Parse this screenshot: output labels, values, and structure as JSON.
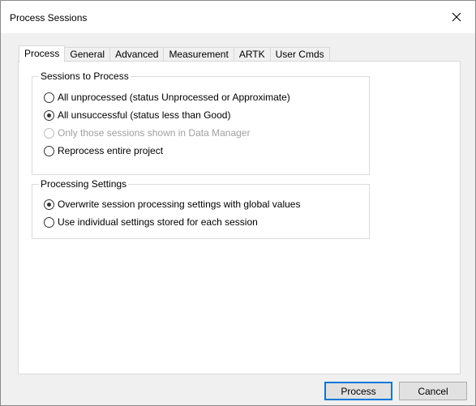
{
  "window": {
    "title": "Process Sessions",
    "close_glyph": "✕"
  },
  "tabs": [
    {
      "label": "Process",
      "active": true
    },
    {
      "label": "General",
      "active": false
    },
    {
      "label": "Advanced",
      "active": false
    },
    {
      "label": "Measurement",
      "active": false
    },
    {
      "label": "ARTK",
      "active": false
    },
    {
      "label": "User Cmds",
      "active": false
    }
  ],
  "sessions_group": {
    "title": "Sessions to Process",
    "options": [
      {
        "label": "All unprocessed (status Unprocessed or Approximate)",
        "checked": false,
        "enabled": true
      },
      {
        "label": "All unsuccessful (status less than Good)",
        "checked": true,
        "enabled": true
      },
      {
        "label": "Only those sessions shown in Data Manager",
        "checked": false,
        "enabled": false
      },
      {
        "label": "Reprocess entire project",
        "checked": false,
        "enabled": true
      }
    ]
  },
  "settings_group": {
    "title": "Processing Settings",
    "options": [
      {
        "label": "Overwrite session processing settings with global values",
        "checked": true,
        "enabled": true
      },
      {
        "label": "Use individual settings stored for each session",
        "checked": false,
        "enabled": true
      }
    ]
  },
  "buttons": {
    "process": "Process",
    "cancel": "Cancel"
  }
}
